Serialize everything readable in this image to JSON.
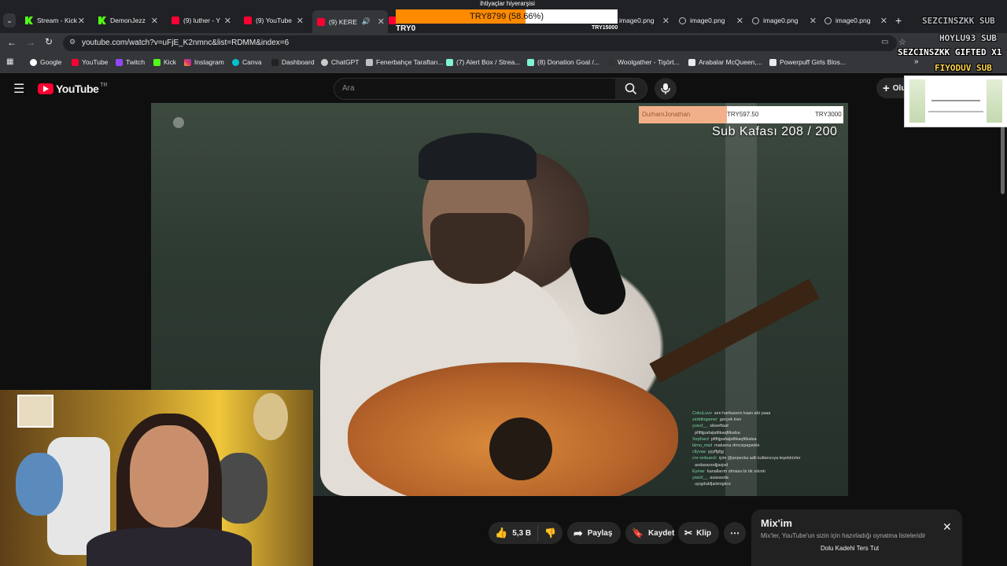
{
  "browser": {
    "tabs": [
      {
        "label": "Stream - Kick",
        "fav": "kick"
      },
      {
        "label": "DemonJezz",
        "fav": "kick"
      },
      {
        "label": "(9) luther - Y",
        "fav": "yt"
      },
      {
        "label": "(9) YouTube",
        "fav": "yt"
      },
      {
        "label": "(9) KERE",
        "fav": "yt"
      },
      {
        "label": "",
        "fav": "yt"
      },
      {
        "label": "image0.png",
        "fav": "globe"
      },
      {
        "label": "image0.png",
        "fav": "globe"
      },
      {
        "label": "image0.png",
        "fav": "globe"
      },
      {
        "label": "image0.png",
        "fav": "globe"
      }
    ],
    "url": "youtube.com/watch?v=uFjE_K2nmnc&list=RDMM&index=6",
    "bookmarks": [
      "Google",
      "YouTube",
      "Twitch",
      "Kick",
      "Instagram",
      "Canva",
      "Dashboard",
      "ChatGPT",
      "Fenerbahçe Taraftarı...",
      "(7) Alert Box / Strea...",
      "(8) Donation Goal /...",
      "Woolgather - Tişört...",
      "Arabalar McQueen,...",
      "Powerpuff Girls Blos..."
    ]
  },
  "youtube": {
    "logo_text": "YouTube",
    "region": "TR",
    "search_placeholder": "Ara",
    "create_label": "Oluştur"
  },
  "video": {
    "donation_bar": {
      "left": "DurhamJonathan",
      "mid": "TRY597.50",
      "right": "TRY3000"
    },
    "sub_counter": "Sub Kafası 208 / 200",
    "chat": [
      {
        "user": "CokuLuvo",
        "msg": "sen harikasınn kaan abi yaaa"
      },
      {
        "user": "zeddingamer",
        "msg": "gerçek tren"
      },
      {
        "user": "yusuf__",
        "msg": "sikeeftaaf"
      },
      {
        "user": "",
        "msg": "pfiftijpafaijafitkaqfitkalsa"
      },
      {
        "user": "Xephard",
        "msg": "pfiftijpafaijafitkaqfitkalsa"
      },
      {
        "user": "bimo_mail",
        "msg": "makarna dmcsipapwkle"
      },
      {
        "user": "cllyvaa",
        "msg": "yyyffgfgj"
      },
      {
        "user": "cnr-reduarcli",
        "msg": "içim @popecka adlı kullanıcıya teşekkürler"
      },
      {
        "user": "",
        "msg": "asdasaoodjjasjsd"
      },
      {
        "user": "Eymer",
        "msg": "kanallarım olmasu bi tık sıkıntı"
      },
      {
        "user": "yasüf__",
        "msg": "asasasda"
      },
      {
        "user": "",
        "msg": "uyıgdubfjarbnigkcx"
      }
    ]
  },
  "actions": {
    "likes": "5,3 B",
    "share": "Paylaş",
    "save": "Kaydet",
    "clip": "Klip"
  },
  "mix_panel": {
    "title": "Mix'im",
    "subtitle": "Mix'ler, YouTube'un sizin için hazırladığı oynatma listeleridir",
    "next_item": "Dolu Kadehi Ters Tut"
  },
  "overlay": {
    "goal_title": "ihtiyaçlar hiyerarşisi",
    "goal_text": "TRY8799 (58.66%)",
    "goal_progress": 0.5866,
    "goal_start": "TRY0",
    "goal_end": "TRY15000",
    "gift_line1": "SEZCINSZKK SUB",
    "gift_line2": "HOYLU93 SUB",
    "gift_line3": "SEZCINSZKK GIFTED X1",
    "gift_line4": "FIYODUV SUB"
  }
}
